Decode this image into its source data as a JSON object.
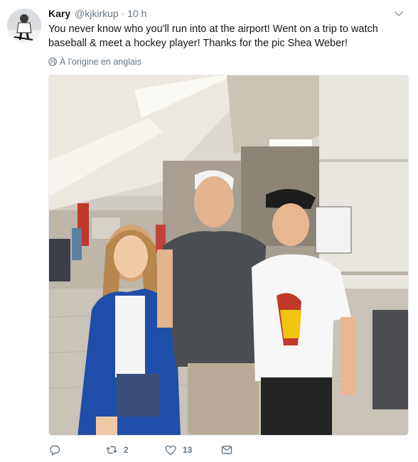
{
  "tweet": {
    "display_name": "Kary",
    "handle": "@kjkirkup",
    "separator": "·",
    "time": "10 h",
    "text": "You never know who you'll run into at the airport! Went on a trip to watch baseball & meet a hockey player! Thanks for the pic Shea Weber!",
    "translation_note": "À l'origine en anglais"
  },
  "actions": {
    "retweet_count": "2",
    "like_count": "13"
  },
  "icons": {
    "more": "chevron-down-icon",
    "globe": "globe-icon",
    "reply": "reply-icon",
    "retweet": "retweet-icon",
    "like": "heart-icon",
    "message": "envelope-icon"
  },
  "colors": {
    "text": "#14171a",
    "muted": "#657786"
  }
}
